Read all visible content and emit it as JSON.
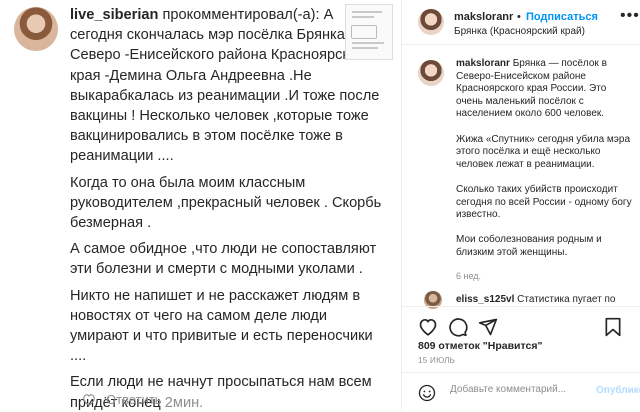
{
  "comment": {
    "username": "live_siberian",
    "intro": " прокомментировал(-а): А сегодня скончалась мэр посёлка Брянка Северо -Енисейского района Красноярского края -Демина Ольга Андреевна .Не выкарабкалась из реанимации .И тоже после вакцины ! Несколько человек ,которые тоже вакцинировались в этом посёлке тоже в реанимации ....",
    "paragraphs": [
      "Когда то она была моим классным руководителем ,прекрасный человек . Скорбь безмерная .",
      "А самое обидное ,что люди не сопоставляют эти болезни и смерти с модными уколами .",
      "Никто не напишет и не расскажет людям в новостях от чего на самом деле люди умирают и что привитые и есть переносчики ...."
    ],
    "last_text": "Если люди не начнут просыпаться нам всем придёт конец ",
    "timestamp": "2мин.",
    "reply_label": "Ответить"
  },
  "post": {
    "author": "maksloranr",
    "follow_label": "Подписаться",
    "location": "Брянка (Красноярский край)",
    "caption_paragraphs": [
      "Брянка — посёлок в Северо-Енисейском районе Красноярского края России. Это очень маленький посёлок с населением около 600 человек.",
      "Жижа «Спутник» сегодня убила мэра этого посёлка и ещё несколько человек лежат в реанимации.",
      "Сколько таких убийств происходит сегодня по всей России - одному богу известно.",
      "Мои соболезнования родным и близким этой женщины."
    ],
    "caption_age": "6 нед.",
    "second_comment": {
      "username": "eliss_s125vl",
      "text": "Статистика пугает по"
    },
    "likes": "809 отметок \"Нравится\"",
    "date": "15 ИЮЛЬ",
    "add_comment_placeholder": "Добавьте комментарий...",
    "publish_label": "Опубликовать"
  },
  "colors": {
    "link_blue": "#0095f6",
    "muted": "#8e8e8e",
    "disabled_blue": "#b3dbff"
  },
  "icons": [
    "heart-icon",
    "comment-icon",
    "share-icon",
    "bookmark-icon",
    "smile-icon",
    "more-icon"
  ]
}
